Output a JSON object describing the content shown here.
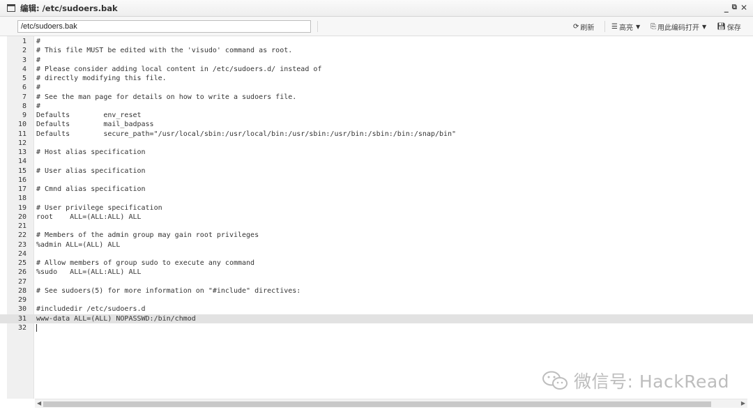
{
  "window": {
    "title": "编辑: /etc/sudoers.bak",
    "minimize_glyph": "_",
    "restore_glyph": "⧉",
    "close_glyph": "✕"
  },
  "toolbar": {
    "path_value": "/etc/sudoers.bak",
    "refresh_label": "刷新",
    "highlight_label": "高亮",
    "open_with_encoding_label": "用此编码打开",
    "save_label": "保存",
    "refresh_icon": "refresh-icon",
    "highlight_icon": "list-icon",
    "encoding_icon": "encoding-icon",
    "save_icon": "floppy-disk-icon"
  },
  "editor": {
    "active_line": 31,
    "cursor_line": 32,
    "lines": [
      {
        "n": "1",
        "text": "#"
      },
      {
        "n": "2",
        "text": "# This file MUST be edited with the 'visudo' command as root."
      },
      {
        "n": "3",
        "text": "#"
      },
      {
        "n": "4",
        "text": "# Please consider adding local content in /etc/sudoers.d/ instead of"
      },
      {
        "n": "5",
        "text": "# directly modifying this file."
      },
      {
        "n": "6",
        "text": "#"
      },
      {
        "n": "7",
        "text": "# See the man page for details on how to write a sudoers file."
      },
      {
        "n": "8",
        "text": "#"
      },
      {
        "n": "9",
        "text": "Defaults\tenv_reset"
      },
      {
        "n": "10",
        "text": "Defaults\tmail_badpass"
      },
      {
        "n": "11",
        "text": "Defaults\tsecure_path=\"/usr/local/sbin:/usr/local/bin:/usr/sbin:/usr/bin:/sbin:/bin:/snap/bin\""
      },
      {
        "n": "12",
        "text": ""
      },
      {
        "n": "13",
        "text": "# Host alias specification"
      },
      {
        "n": "14",
        "text": ""
      },
      {
        "n": "15",
        "text": "# User alias specification"
      },
      {
        "n": "16",
        "text": ""
      },
      {
        "n": "17",
        "text": "# Cmnd alias specification"
      },
      {
        "n": "18",
        "text": ""
      },
      {
        "n": "19",
        "text": "# User privilege specification"
      },
      {
        "n": "20",
        "text": "root\tALL=(ALL:ALL) ALL"
      },
      {
        "n": "21",
        "text": ""
      },
      {
        "n": "22",
        "text": "# Members of the admin group may gain root privileges"
      },
      {
        "n": "23",
        "text": "%admin ALL=(ALL) ALL"
      },
      {
        "n": "24",
        "text": ""
      },
      {
        "n": "25",
        "text": "# Allow members of group sudo to execute any command"
      },
      {
        "n": "26",
        "text": "%sudo\tALL=(ALL:ALL) ALL"
      },
      {
        "n": "27",
        "text": ""
      },
      {
        "n": "28",
        "text": "# See sudoers(5) for more information on \"#include\" directives:"
      },
      {
        "n": "29",
        "text": ""
      },
      {
        "n": "30",
        "text": "#includedir /etc/sudoers.d"
      },
      {
        "n": "31",
        "text": "www-data ALL=(ALL) NOPASSWD:/bin/chmod"
      },
      {
        "n": "32",
        "text": ""
      }
    ]
  },
  "watermark": {
    "text": "微信号: HackRead",
    "color": "#bdbdbd"
  }
}
